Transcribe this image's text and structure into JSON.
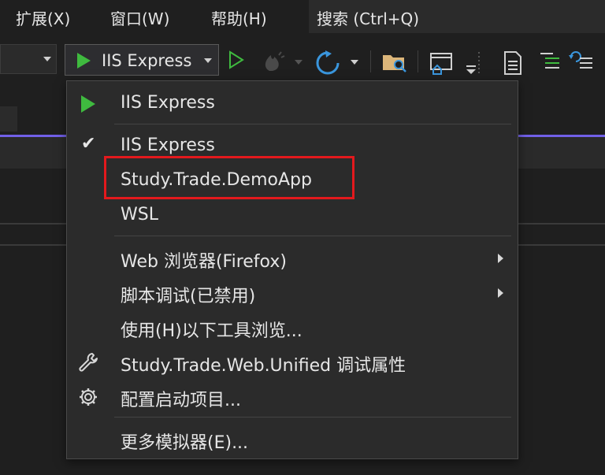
{
  "menubar": {
    "items": [
      "扩展(X)",
      "窗口(W)",
      "帮助(H)"
    ],
    "search": "搜索 (Ctrl+Q)"
  },
  "toolbar": {
    "run_label": "IIS Express"
  },
  "dropdown": {
    "items": [
      {
        "label": "IIS Express",
        "icon": "play-icon"
      },
      {
        "label": "IIS Express",
        "icon": "checkmark-icon"
      },
      {
        "label": "Study.Trade.DemoApp",
        "icon": ""
      },
      {
        "label": "WSL",
        "icon": ""
      },
      {
        "label": "Web 浏览器(Firefox)",
        "icon": "",
        "submenu": true
      },
      {
        "label": "脚本调试(已禁用)",
        "icon": "",
        "submenu": true
      },
      {
        "label": "使用(H)以下工具浏览...",
        "icon": ""
      },
      {
        "label": "Study.Trade.Web.Unified 调试属性",
        "icon": "wrench-icon"
      },
      {
        "label": "配置启动项目...",
        "icon": "gear-icon"
      },
      {
        "label": "更多模拟器(E)...",
        "icon": ""
      }
    ]
  },
  "colors": {
    "accent": "#7160e8",
    "play_green": "#3fba3f",
    "highlight_red": "#e3191d",
    "refresh_blue": "#3a96dd"
  }
}
